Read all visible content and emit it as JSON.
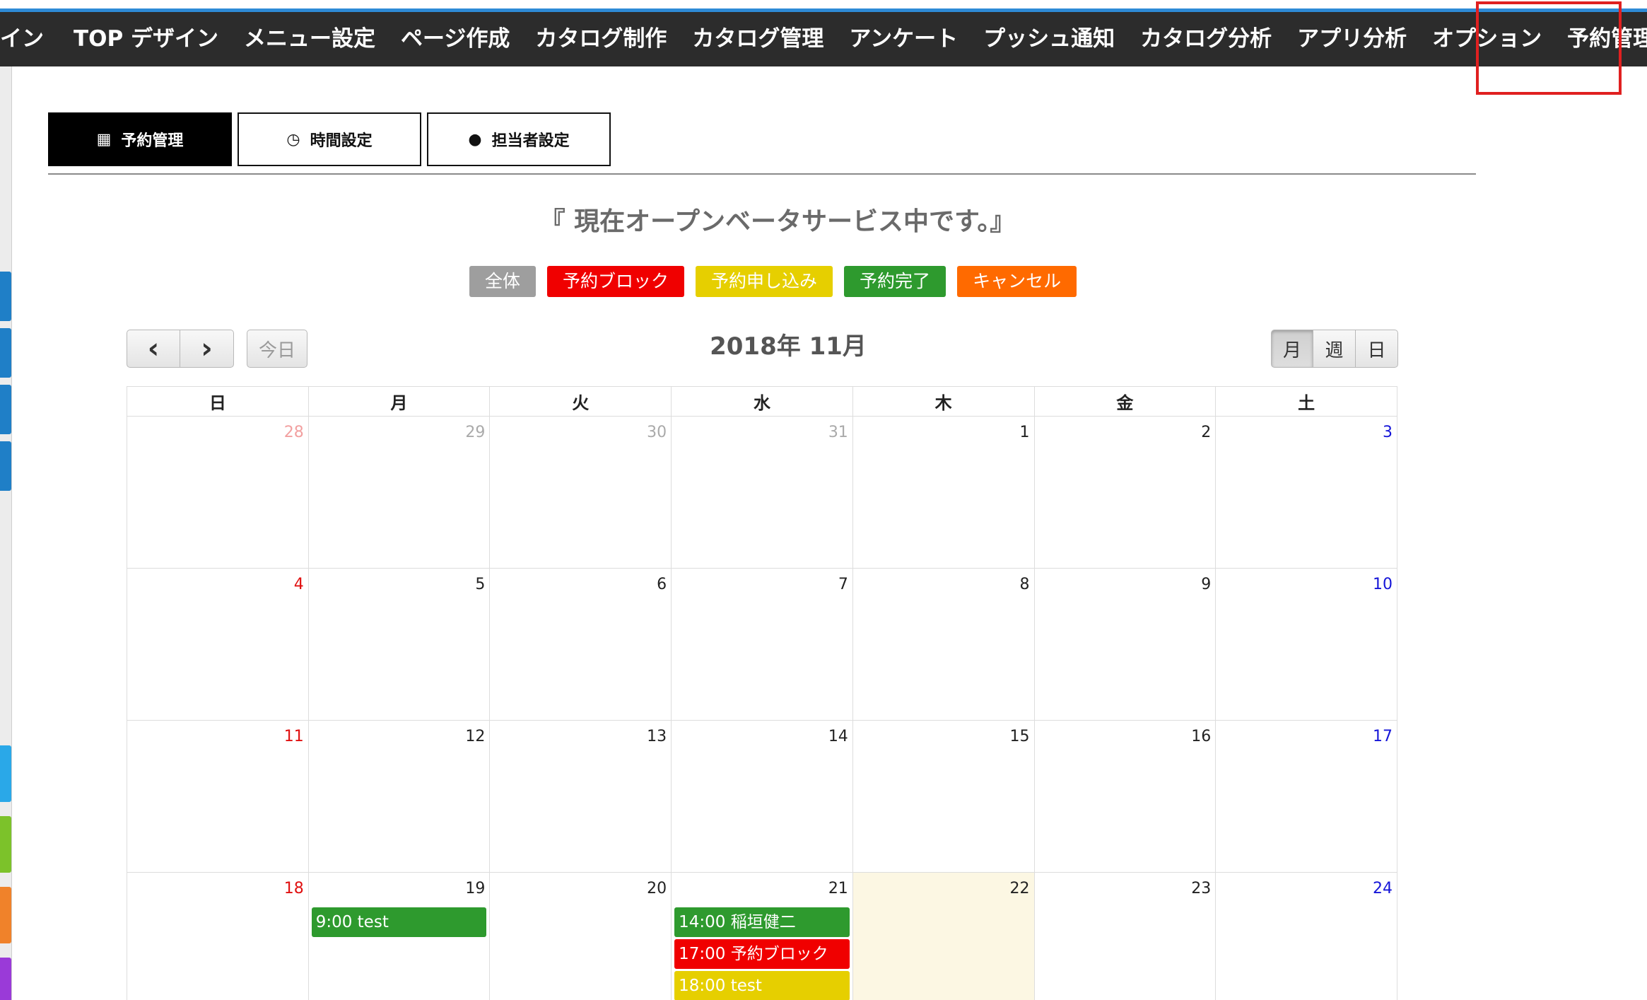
{
  "colors": {
    "all": "#9e9e9e",
    "block": "#f00000",
    "request": "#e6cf00",
    "complete": "#2e9a2e",
    "cancel": "#ff6a00"
  },
  "nav": {
    "items": [
      "イン",
      "TOP デザイン",
      "メニュー設定",
      "ページ作成",
      "カタログ制作",
      "カタログ管理",
      "アンケート",
      "プッシュ通知",
      "カタログ分析",
      "アプリ分析",
      "オプション",
      "予約管理"
    ]
  },
  "tabs": [
    {
      "label": "予約管理",
      "icon": "calendar-icon"
    },
    {
      "label": "時間設定",
      "icon": "clock-icon"
    },
    {
      "label": "担当者設定",
      "icon": "users-icon"
    }
  ],
  "beta_message": "『 現在オープンベータサービス中です。』",
  "legend": [
    {
      "label": "全体",
      "color": "#9e9e9e"
    },
    {
      "label": "予約ブロック",
      "color": "#f00000"
    },
    {
      "label": "予約申し込み",
      "color": "#e6cf00"
    },
    {
      "label": "予約完了",
      "color": "#2e9a2e"
    },
    {
      "label": "キャンセル",
      "color": "#ff6a00"
    }
  ],
  "toolbar": {
    "prev_icon": "‹",
    "next_icon": "›",
    "today_label": "今日",
    "title": "2018年 11月",
    "views": [
      "月",
      "週",
      "日"
    ],
    "active_view": "月"
  },
  "calendar": {
    "weekdays": [
      "日",
      "月",
      "火",
      "水",
      "木",
      "金",
      "土"
    ],
    "weeks": [
      [
        {
          "day": "28",
          "kind": "other-sun"
        },
        {
          "day": "29",
          "kind": "other"
        },
        {
          "day": "30",
          "kind": "other"
        },
        {
          "day": "31",
          "kind": "other"
        },
        {
          "day": "1",
          "kind": "normal"
        },
        {
          "day": "2",
          "kind": "normal"
        },
        {
          "day": "3",
          "kind": "sat"
        }
      ],
      [
        {
          "day": "4",
          "kind": "sun"
        },
        {
          "day": "5",
          "kind": "normal"
        },
        {
          "day": "6",
          "kind": "normal"
        },
        {
          "day": "7",
          "kind": "normal"
        },
        {
          "day": "8",
          "kind": "normal"
        },
        {
          "day": "9",
          "kind": "normal"
        },
        {
          "day": "10",
          "kind": "sat"
        }
      ],
      [
        {
          "day": "11",
          "kind": "sun"
        },
        {
          "day": "12",
          "kind": "normal"
        },
        {
          "day": "13",
          "kind": "normal"
        },
        {
          "day": "14",
          "kind": "normal"
        },
        {
          "day": "15",
          "kind": "normal"
        },
        {
          "day": "16",
          "kind": "normal"
        },
        {
          "day": "17",
          "kind": "sat"
        }
      ],
      [
        {
          "day": "18",
          "kind": "sun"
        },
        {
          "day": "19",
          "kind": "normal",
          "events": [
            {
              "text": "9:00 test",
              "status": "complete"
            }
          ]
        },
        {
          "day": "20",
          "kind": "normal"
        },
        {
          "day": "21",
          "kind": "normal",
          "events": [
            {
              "text": "14:00 稲垣健二",
              "status": "complete"
            },
            {
              "text": "17:00 予約ブロック",
              "status": "block"
            },
            {
              "text": "18:00 test",
              "status": "request"
            }
          ]
        },
        {
          "day": "22",
          "kind": "normal",
          "today": true
        },
        {
          "day": "23",
          "kind": "normal"
        },
        {
          "day": "24",
          "kind": "sat"
        }
      ]
    ]
  }
}
